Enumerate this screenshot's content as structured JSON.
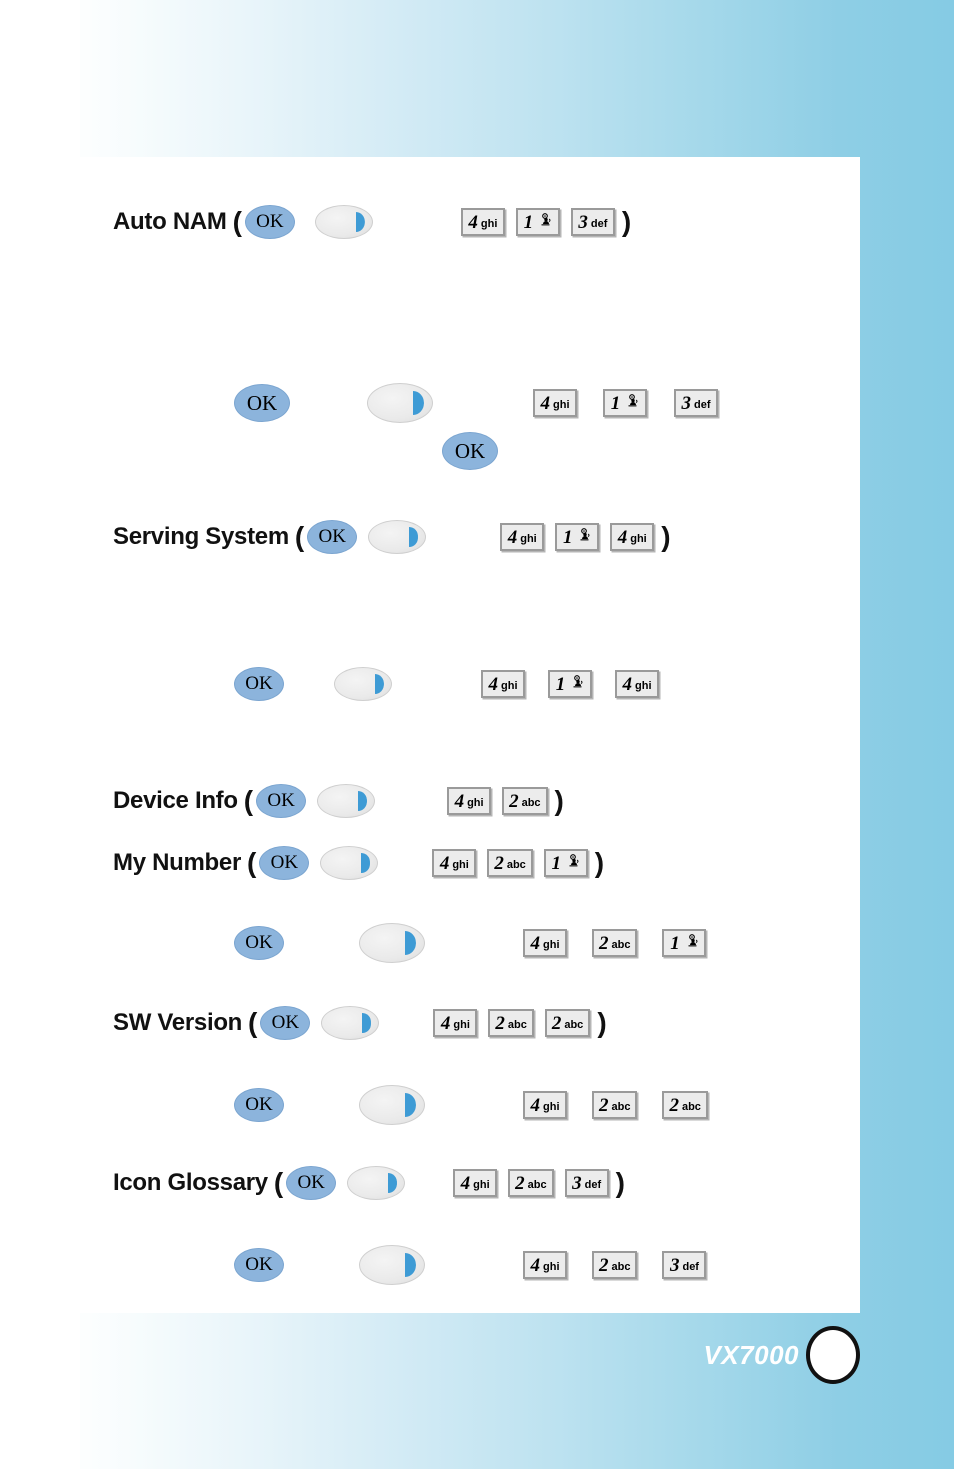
{
  "document": {
    "model": "VX7000"
  },
  "footer": {
    "brand": "VX7000",
    "circle_icon": "circle-icon"
  },
  "keys": {
    "ok_label": "OK",
    "nav_icon": "right-navigation-key-icon",
    "k4": {
      "digit": "4",
      "letters": "ghi"
    },
    "k1": {
      "digit": "1",
      "letters": "",
      "glyph": "voicemail-icon"
    },
    "k3": {
      "digit": "3",
      "letters": "def"
    },
    "k2": {
      "digit": "2",
      "letters": "abc"
    },
    "open_paren": "(",
    "close_paren": ")"
  },
  "sections": [
    {
      "id": "auto-nam",
      "label": "Auto NAM",
      "inline_sequence": [
        "OK",
        "nav",
        "4 ghi",
        "1",
        "3 def"
      ],
      "expanded_sequence": [
        "OK",
        "nav",
        "4 ghi",
        "1",
        "3 def",
        "OK"
      ]
    },
    {
      "id": "serving-system",
      "label": "Serving System",
      "inline_sequence": [
        "OK",
        "nav",
        "4 ghi",
        "1",
        "4 ghi"
      ],
      "expanded_sequence": [
        "OK",
        "nav",
        "4 ghi",
        "1",
        "4 ghi"
      ]
    },
    {
      "id": "device-info",
      "label": "Device Info",
      "inline_sequence": [
        "OK",
        "nav",
        "4 ghi",
        "2 abc"
      ],
      "expanded_sequence": []
    },
    {
      "id": "my-number",
      "label": "My Number",
      "inline_sequence": [
        "OK",
        "nav",
        "4 ghi",
        "2 abc",
        "1"
      ],
      "expanded_sequence": [
        "OK",
        "nav",
        "4 ghi",
        "2 abc",
        "1"
      ]
    },
    {
      "id": "sw-version",
      "label": "SW Version",
      "inline_sequence": [
        "OK",
        "nav",
        "4 ghi",
        "2 abc",
        "2 abc"
      ],
      "expanded_sequence": [
        "OK",
        "nav",
        "4 ghi",
        "2 abc",
        "2 abc"
      ]
    },
    {
      "id": "icon-glossary",
      "label": "Icon Glossary",
      "inline_sequence": [
        "OK",
        "nav",
        "4 ghi",
        "2 abc",
        "3 def"
      ],
      "expanded_sequence": [
        "OK",
        "nav",
        "4 ghi",
        "2 abc",
        "3 def"
      ]
    }
  ],
  "colors": {
    "ok_key_blue": "#8CB4DC",
    "nav_crescent_blue": "#3E9BD5",
    "num_key_fill": "#ECECEC",
    "num_key_border": "#9A9A9A",
    "page_gradient_end": "#85CBE4",
    "panel_background": "#FFFFFF",
    "text": "#111111"
  }
}
